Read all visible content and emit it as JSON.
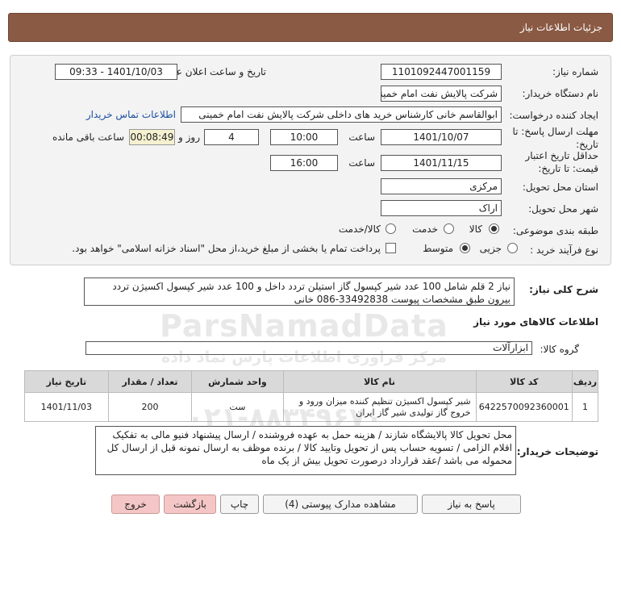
{
  "page": {
    "title": "جزئیات اطلاعات نیاز"
  },
  "form": {
    "need_number_label": "شماره نیاز:",
    "need_number": "1101092447001159",
    "announce_label": "تاریخ و ساعت اعلان عمومی:",
    "announce_value": "1401/10/03 - 09:33",
    "buyer_org_label": "نام دستگاه خریدار:",
    "buyer_org": "شرکت پالایش نفت امام خمینی  ره  شازند",
    "creator_label": "ایجاد کننده درخواست:",
    "creator": "ابوالقاسم  خانی  کارشناس خرید های داخلی  شرکت پالایش نفت امام خمینی",
    "contact_link": "اطلاعات تماس خریدار",
    "deadline_label_1": "مهلت ارسال پاسخ: تا",
    "deadline_label_2": "تاریخ:",
    "deadline_date": "1401/10/07",
    "time_label": "ساعت",
    "deadline_time": "10:00",
    "days_value": "4",
    "days_label": "روز و",
    "remaining_value": "00:08:49",
    "remaining_label": "ساعت باقی مانده",
    "validity_label_1": "حداقل تاریخ اعتبار",
    "validity_label_2": "قیمت: تا تاریخ:",
    "validity_date": "1401/11/15",
    "validity_time_label": "ساعت",
    "validity_time": "16:00",
    "province_label": "استان محل تحویل:",
    "province": "مرکزی",
    "city_label": "شهر محل تحویل:",
    "city": "اراک",
    "category_label": "طبقه بندی موضوعی:",
    "category_options": [
      "کالا",
      "خدمت",
      "کالا/خدمت"
    ],
    "purchase_label": "نوع فرآیند خرید :",
    "purchase_options": [
      "جزیی",
      "متوسط"
    ],
    "payment_note": "پرداخت تمام یا بخشی از مبلغ خرید،از محل \"اسناد خزانه اسلامی\" خواهد بود."
  },
  "description": {
    "label": "شرح کلی نیاز:",
    "text": "نیاز 2 قلم شامل 100 عدد شیر کپسول گاز استیلن تردد داخل و 100 عدد شیر کپسول اکسیژن تردد بیرون طبق مشخصات پیوست 33492838-086 خانی"
  },
  "goods": {
    "section_title": "اطلاعات کالاهای مورد نیاز",
    "group_label": "گروه کالا:",
    "group_value": "ابزارآلات",
    "columns": [
      "ردیف",
      "کد کالا",
      "نام کالا",
      "واحد شمارش",
      "تعداد / مقدار",
      "تاریخ نیاز"
    ],
    "rows": [
      {
        "row": "1",
        "code": "6422570092360001",
        "name": "شیر کپسول اکسیژن تنظیم کننده میزان ورود و خروج گاز تولیدی شیر گاز ایران",
        "unit": "ست",
        "qty": "200",
        "date": "1401/11/03"
      }
    ]
  },
  "buyer_notes": {
    "label": "توضیحات خریدار:",
    "text": "محل تحویل کالا پالایشگاه شازند / هزینه حمل به عهده فروشنده / ارسال پیشنهاد فنیو مالی به تفکیک اقلام الزامی / تسویه حساب پس از تحویل وتایید کالا / برنده موظف به ارسال نمونه قبل از ارسال کل محموله می باشد /عقد قرارداد درصورت تحویل بیش از یک ماه"
  },
  "buttons": {
    "reply": "پاسخ به نیاز",
    "attachments": "مشاهده مدارک پیوستی (4)",
    "print": "چاپ",
    "back": "بازگشت",
    "exit": "خروج"
  },
  "watermark": {
    "brand": "ParsNamadData",
    "line_fa": "مرکز فراوری اطلاعات پارس نماد داده",
    "phone": "۰۲۱-۸۸۳۴۹۶۷۰"
  }
}
